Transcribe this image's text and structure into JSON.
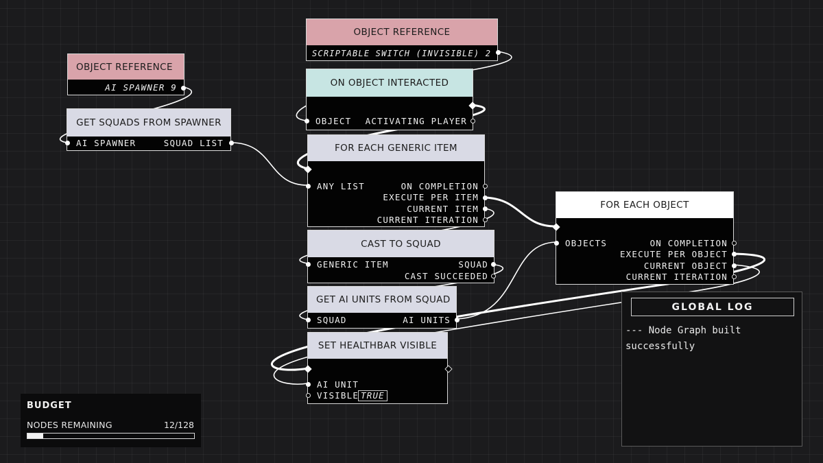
{
  "nodes": {
    "obj_ref_spawner": {
      "title": "OBJECT REFERENCE",
      "value": "AI SPAWNER 9"
    },
    "obj_ref_switch": {
      "title": "OBJECT REFERENCE",
      "value": "SCRIPTABLE SWITCH (INVISIBLE) 2"
    },
    "on_interacted": {
      "title": "ON OBJECT INTERACTED",
      "out1": "OBJECT",
      "out2": "ACTIVATING PLAYER"
    },
    "get_squads": {
      "title": "GET SQUADS FROM SPAWNER",
      "in1": "AI SPAWNER",
      "out1": "SQUAD LIST"
    },
    "for_each_generic": {
      "title": "FOR EACH GENERIC ITEM",
      "in1": "ANY LIST",
      "out1": "ON COMPLETION",
      "out2": "EXECUTE PER ITEM",
      "out3": "CURRENT ITEM",
      "out4": "CURRENT ITERATION"
    },
    "cast_squad": {
      "title": "CAST TO SQUAD",
      "in1": "GENERIC ITEM",
      "out1": "SQUAD",
      "out2": "CAST SUCCEEDED"
    },
    "get_ai_units": {
      "title": "GET AI UNITS FROM SQUAD",
      "in1": "SQUAD",
      "out1": "AI UNITS"
    },
    "set_healthbar": {
      "title": "SET HEALTHBAR VISIBLE",
      "in1": "AI UNIT",
      "in2": "VISIBLE",
      "in2_value": "TRUE"
    },
    "for_each_object": {
      "title": "FOR EACH OBJECT",
      "in1": "OBJECTS",
      "out1": "ON COMPLETION",
      "out2": "EXECUTE PER OBJECT",
      "out3": "CURRENT OBJECT",
      "out4": "CURRENT ITERATION"
    }
  },
  "budget": {
    "title": "BUDGET",
    "label": "NODES REMAINING",
    "value": "12/128",
    "used_fraction": 0.094
  },
  "log": {
    "title": "GLOBAL LOG",
    "message": "--- Node Graph built successfully"
  },
  "colors": {
    "reference_header": "#d9a3aa",
    "event_header": "#c7e5e3",
    "function_header": "#d9dae5",
    "loop_header": "#ffffff",
    "wire": "#ffffff"
  }
}
